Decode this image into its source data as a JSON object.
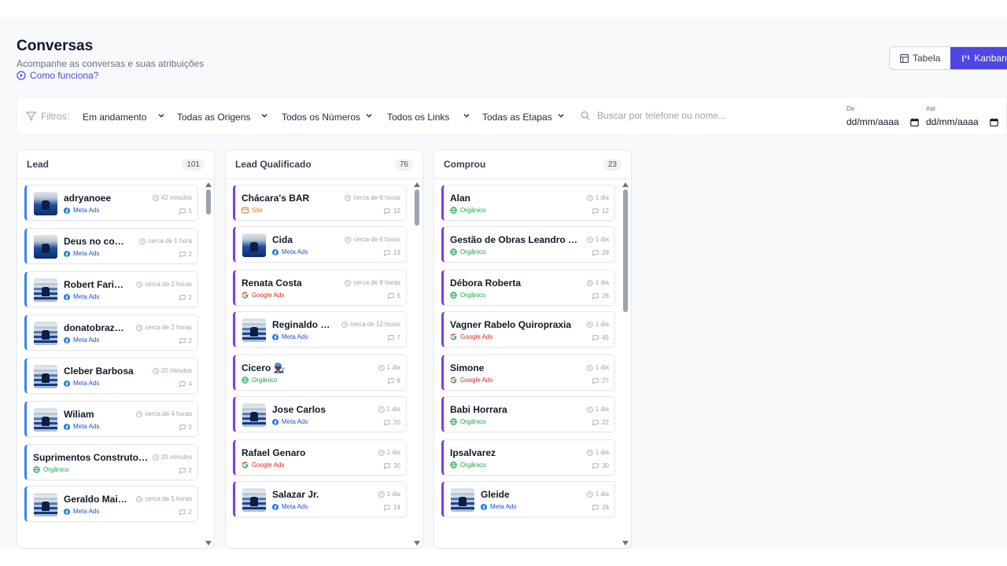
{
  "header": {
    "title": "Conversas",
    "subtitle": "Acompanhe as conversas e suas atribuições",
    "help_link": "Como funciona?"
  },
  "view_toggle": {
    "table_label": "Tabela",
    "kanban_label": "Kanban",
    "active": "Kanban"
  },
  "filters": {
    "label": "Filtros:",
    "status": "Em andamento",
    "origins": "Todas as Origens",
    "numbers": "Todos os Números",
    "links": "Todos os Links",
    "stages": "Todas as Etapas",
    "search_placeholder": "Buscar por telefone ou nome...",
    "date_from_label": "De",
    "date_from_value": "dd/mm/aaaa",
    "date_to_label": "Até",
    "date_to_value": "dd/mm/aaaa"
  },
  "colors": {
    "accent": "#4f46e5",
    "lead_border": "#3b82f6",
    "purple_border": "#7c3aed",
    "meta": "#1d4ed8",
    "organico": "#16a34a",
    "google": "#dc2626",
    "site": "#d97706"
  },
  "columns": [
    {
      "title": "Lead",
      "count": "101",
      "scroll_thumb": 0.07,
      "cards": [
        {
          "name": "adryanoee",
          "source": "Meta Ads",
          "source_type": "meta",
          "time": "42 minutos",
          "messages": "1",
          "avatar": true,
          "avatar_style": "photo"
        },
        {
          "name": "Deus no comando",
          "source": "Meta Ads",
          "source_type": "meta",
          "time": "cerca de 1 hora",
          "messages": "2",
          "avatar": true,
          "avatar_style": "photo"
        },
        {
          "name": "Robert Faria (Azevedo)",
          "source": "Meta Ads",
          "source_type": "meta",
          "time": "cerca de 2 horas",
          "messages": "2",
          "avatar": true,
          "avatar_style": "flag"
        },
        {
          "name": "donatobraz@hotmail.com",
          "source": "Meta Ads",
          "source_type": "meta",
          "time": "cerca de 2 horas",
          "messages": "2",
          "avatar": true,
          "avatar_style": "flag"
        },
        {
          "name": "Cleber Barbosa",
          "source": "Meta Ads",
          "source_type": "meta",
          "time": "20 minutos",
          "messages": "4",
          "avatar": true,
          "avatar_style": "flag"
        },
        {
          "name": "Wiliam",
          "source": "Meta Ads",
          "source_type": "meta",
          "time": "cerca de 4 horas",
          "messages": "2",
          "avatar": true,
          "avatar_style": "flag"
        },
        {
          "name": "Suprimentos Construtora Valle",
          "source": "Orgânico",
          "source_type": "organico",
          "time": "20 minutos",
          "messages": "2",
          "avatar": false
        },
        {
          "name": "Geraldo Maia Dantas",
          "source": "Meta Ads",
          "source_type": "meta",
          "time": "cerca de 5 horas",
          "messages": "2",
          "avatar": true,
          "avatar_style": "flag"
        }
      ]
    },
    {
      "title": "Lead Qualificado",
      "count": "76",
      "scroll_thumb": 0.1,
      "cards": [
        {
          "name": "Chácara's BAR",
          "source": "Site",
          "source_type": "site",
          "time": "cerca de 6 horas",
          "messages": "12",
          "avatar": false
        },
        {
          "name": "Cida",
          "source": "Meta Ads",
          "source_type": "meta",
          "time": "cerca de 6 horas",
          "messages": "13",
          "avatar": true,
          "avatar_style": "photo"
        },
        {
          "name": "Renata Costa",
          "source": "Google Ads",
          "source_type": "google",
          "time": "cerca de 9 horas",
          "messages": "6",
          "avatar": false
        },
        {
          "name": "Reginaldo Pessoa",
          "source": "Meta Ads",
          "source_type": "meta",
          "time": "cerca de 12 horas",
          "messages": "7",
          "avatar": true,
          "avatar_style": "flag"
        },
        {
          "name": "Cicero 👨🏿‍🔧",
          "source": "Orgânico",
          "source_type": "organico",
          "time": "1 dia",
          "messages": "8",
          "avatar": false
        },
        {
          "name": "Jose Carlos",
          "source": "Meta Ads",
          "source_type": "meta",
          "time": "1 dia",
          "messages": "20",
          "avatar": true,
          "avatar_style": "flag"
        },
        {
          "name": "Rafael Genaro",
          "source": "Google Ads",
          "source_type": "google",
          "time": "1 dia",
          "messages": "30",
          "avatar": false
        },
        {
          "name": "Salazar Jr.",
          "source": "Meta Ads",
          "source_type": "meta",
          "time": "1 dia",
          "messages": "14",
          "avatar": true,
          "avatar_style": "flag"
        }
      ]
    },
    {
      "title": "Comprou",
      "count": "23",
      "scroll_thumb": 0.34,
      "cards": [
        {
          "name": "Alan",
          "source": "Orgânico",
          "source_type": "organico",
          "time": "1 dia",
          "messages": "12",
          "avatar": false
        },
        {
          "name": "Gestão de Obras Leandro Fiuza",
          "source": "Orgânico",
          "source_type": "organico",
          "time": "1 dia",
          "messages": "28",
          "avatar": false
        },
        {
          "name": "Débora Roberta",
          "source": "Orgânico",
          "source_type": "organico",
          "time": "1 dia",
          "messages": "28",
          "avatar": false
        },
        {
          "name": "Vagner Rabelo Quiropraxia",
          "source": "Google Ads",
          "source_type": "google",
          "time": "1 dia",
          "messages": "45",
          "avatar": false
        },
        {
          "name": "Simone",
          "source": "Google Ads",
          "source_type": "google",
          "time": "1 dia",
          "messages": "27",
          "avatar": false
        },
        {
          "name": "Babi Horrara",
          "source": "Orgânico",
          "source_type": "organico",
          "time": "1 dia",
          "messages": "22",
          "avatar": false
        },
        {
          "name": "Ipsalvarez",
          "source": "Orgânico",
          "source_type": "organico",
          "time": "1 dia",
          "messages": "30",
          "avatar": false
        },
        {
          "name": "Gleide",
          "source": "Meta Ads",
          "source_type": "meta",
          "time": "1 dia",
          "messages": "28",
          "avatar": true,
          "avatar_style": "flag"
        }
      ]
    }
  ]
}
